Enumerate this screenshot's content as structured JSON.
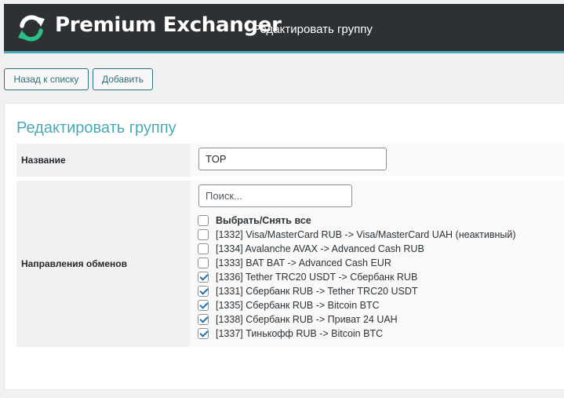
{
  "header": {
    "brand": "Premium Exchanger",
    "subtitle": "- Редактировать группу",
    "logo_icon": "refresh-arrows-icon",
    "accent": "#4aa8b6",
    "logo_green": "#2bbf89"
  },
  "toolbar": {
    "back_label": "Назад к списку",
    "add_label": "Добавить"
  },
  "form": {
    "title": "Редактировать группу",
    "name": {
      "label": "Название",
      "value": "TOP"
    },
    "directions": {
      "label": "Направления обменов",
      "search_placeholder": "Поиск...",
      "select_all": {
        "label": "Выбрать/Снять все",
        "checked": false
      },
      "items": [
        {
          "label": "[1332] Visa/MasterCard RUB -> Visa/MasterCard UAH (неактивный)",
          "checked": false
        },
        {
          "label": "[1334] Avalanche AVAX -> Advanced Cash RUB",
          "checked": false
        },
        {
          "label": "[1333] BAT BAT -> Advanced Cash EUR",
          "checked": false
        },
        {
          "label": "[1336] Tether TRC20 USDT -> Сбербанк RUB",
          "checked": true
        },
        {
          "label": "[1331] Сбербанк RUB -> Tether TRC20 USDT",
          "checked": true
        },
        {
          "label": "[1335] Сбербанк RUB -> Bitcoin BTC",
          "checked": true
        },
        {
          "label": "[1338] Сбербанк RUB -> Приват 24 UAH",
          "checked": true
        },
        {
          "label": "[1337] Тинькофф RUB -> Bitcoin BTC",
          "checked": true
        }
      ]
    }
  }
}
